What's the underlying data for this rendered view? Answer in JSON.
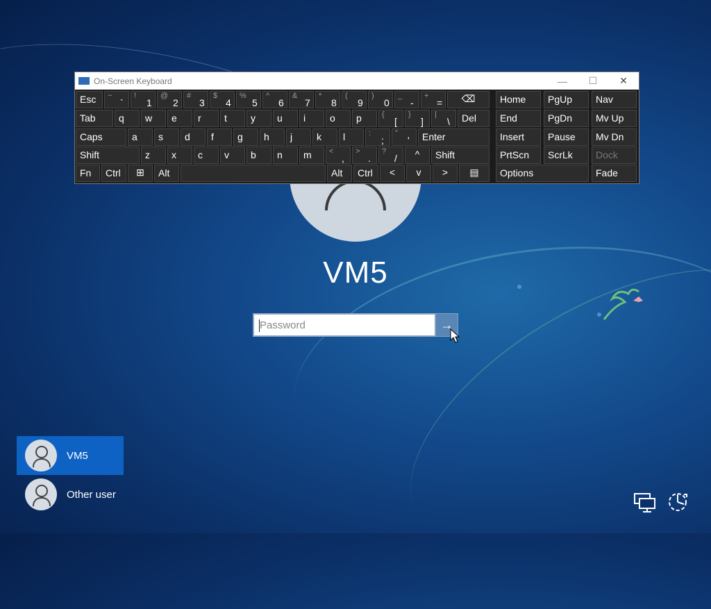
{
  "osk": {
    "title": "On-Screen Keyboard",
    "window_controls": {
      "minimize": "—",
      "maximize": "☐",
      "close": "✕"
    },
    "rows": [
      [
        {
          "id": "esc",
          "main": "Esc"
        },
        {
          "id": "tilde",
          "shift": "~",
          "main": "`"
        },
        {
          "id": "1",
          "shift": "!",
          "main": "1"
        },
        {
          "id": "2",
          "shift": "@",
          "main": "2"
        },
        {
          "id": "3",
          "shift": "#",
          "main": "3"
        },
        {
          "id": "4",
          "shift": "$",
          "main": "4"
        },
        {
          "id": "5",
          "shift": "%",
          "main": "5"
        },
        {
          "id": "6",
          "shift": "^",
          "main": "6"
        },
        {
          "id": "7",
          "shift": "&",
          "main": "7"
        },
        {
          "id": "8",
          "shift": "*",
          "main": "8"
        },
        {
          "id": "9",
          "shift": "(",
          "main": "9"
        },
        {
          "id": "0",
          "shift": ")",
          "main": "0"
        },
        {
          "id": "minus",
          "shift": "_",
          "main": "-"
        },
        {
          "id": "equals",
          "shift": "+",
          "main": "="
        },
        {
          "id": "backspace",
          "main": "⌫"
        },
        {
          "id": "home",
          "main": "Home"
        },
        {
          "id": "pgup",
          "main": "PgUp"
        },
        {
          "id": "nav",
          "main": "Nav"
        }
      ],
      [
        {
          "id": "tab",
          "main": "Tab"
        },
        {
          "id": "q",
          "main": "q"
        },
        {
          "id": "w",
          "main": "w"
        },
        {
          "id": "e",
          "main": "e"
        },
        {
          "id": "r",
          "main": "r"
        },
        {
          "id": "t",
          "main": "t"
        },
        {
          "id": "y",
          "main": "y"
        },
        {
          "id": "u",
          "main": "u"
        },
        {
          "id": "i",
          "main": "i"
        },
        {
          "id": "o",
          "main": "o"
        },
        {
          "id": "p",
          "main": "p"
        },
        {
          "id": "lbracket",
          "shift": "{",
          "main": "["
        },
        {
          "id": "rbracket",
          "shift": "}",
          "main": "]"
        },
        {
          "id": "backslash",
          "shift": "|",
          "main": "\\"
        },
        {
          "id": "del",
          "main": "Del"
        },
        {
          "id": "end",
          "main": "End"
        },
        {
          "id": "pgdn",
          "main": "PgDn"
        },
        {
          "id": "mvup",
          "main": "Mv Up"
        }
      ],
      [
        {
          "id": "caps",
          "main": "Caps"
        },
        {
          "id": "a",
          "main": "a"
        },
        {
          "id": "s",
          "main": "s"
        },
        {
          "id": "d",
          "main": "d"
        },
        {
          "id": "f",
          "main": "f"
        },
        {
          "id": "g",
          "main": "g"
        },
        {
          "id": "h",
          "main": "h"
        },
        {
          "id": "j",
          "main": "j"
        },
        {
          "id": "k",
          "main": "k"
        },
        {
          "id": "l",
          "main": "l"
        },
        {
          "id": "semicolon",
          "shift": ":",
          "main": ";"
        },
        {
          "id": "quote",
          "shift": "\"",
          "main": "'"
        },
        {
          "id": "enter",
          "main": "Enter"
        },
        {
          "id": "insert",
          "main": "Insert"
        },
        {
          "id": "pause",
          "main": "Pause"
        },
        {
          "id": "mvdn",
          "main": "Mv Dn"
        }
      ],
      [
        {
          "id": "lshift",
          "main": "Shift"
        },
        {
          "id": "z",
          "main": "z"
        },
        {
          "id": "x",
          "main": "x"
        },
        {
          "id": "c",
          "main": "c"
        },
        {
          "id": "v",
          "main": "v"
        },
        {
          "id": "b",
          "main": "b"
        },
        {
          "id": "n",
          "main": "n"
        },
        {
          "id": "m",
          "main": "m"
        },
        {
          "id": "comma",
          "shift": "<",
          "main": ","
        },
        {
          "id": "period",
          "shift": ">",
          "main": "."
        },
        {
          "id": "slash",
          "shift": "?",
          "main": "/"
        },
        {
          "id": "up",
          "main": "^"
        },
        {
          "id": "rshift",
          "main": "Shift"
        },
        {
          "id": "prtscn",
          "main": "PrtScn"
        },
        {
          "id": "scrlk",
          "main": "ScrLk"
        },
        {
          "id": "dock",
          "main": "Dock"
        }
      ],
      [
        {
          "id": "fn",
          "main": "Fn"
        },
        {
          "id": "lctrl",
          "main": "Ctrl"
        },
        {
          "id": "win",
          "main": "⊞"
        },
        {
          "id": "lalt",
          "main": "Alt"
        },
        {
          "id": "space",
          "main": ""
        },
        {
          "id": "ralt",
          "main": "Alt"
        },
        {
          "id": "rctrl",
          "main": "Ctrl"
        },
        {
          "id": "left",
          "main": "<"
        },
        {
          "id": "down",
          "main": "v"
        },
        {
          "id": "right",
          "main": ">"
        },
        {
          "id": "menu",
          "main": "▤"
        },
        {
          "id": "options",
          "main": "Options"
        },
        {
          "id": "fade",
          "main": "Fade"
        }
      ]
    ]
  },
  "login": {
    "username": "VM5",
    "password_placeholder": "Password",
    "submit_glyph": "→"
  },
  "users": [
    {
      "name": "VM5",
      "selected": true
    },
    {
      "name": "Other user",
      "selected": false
    }
  ],
  "colors": {
    "selected_user": "#0e62c4",
    "submit_button": "#5a86b6"
  }
}
